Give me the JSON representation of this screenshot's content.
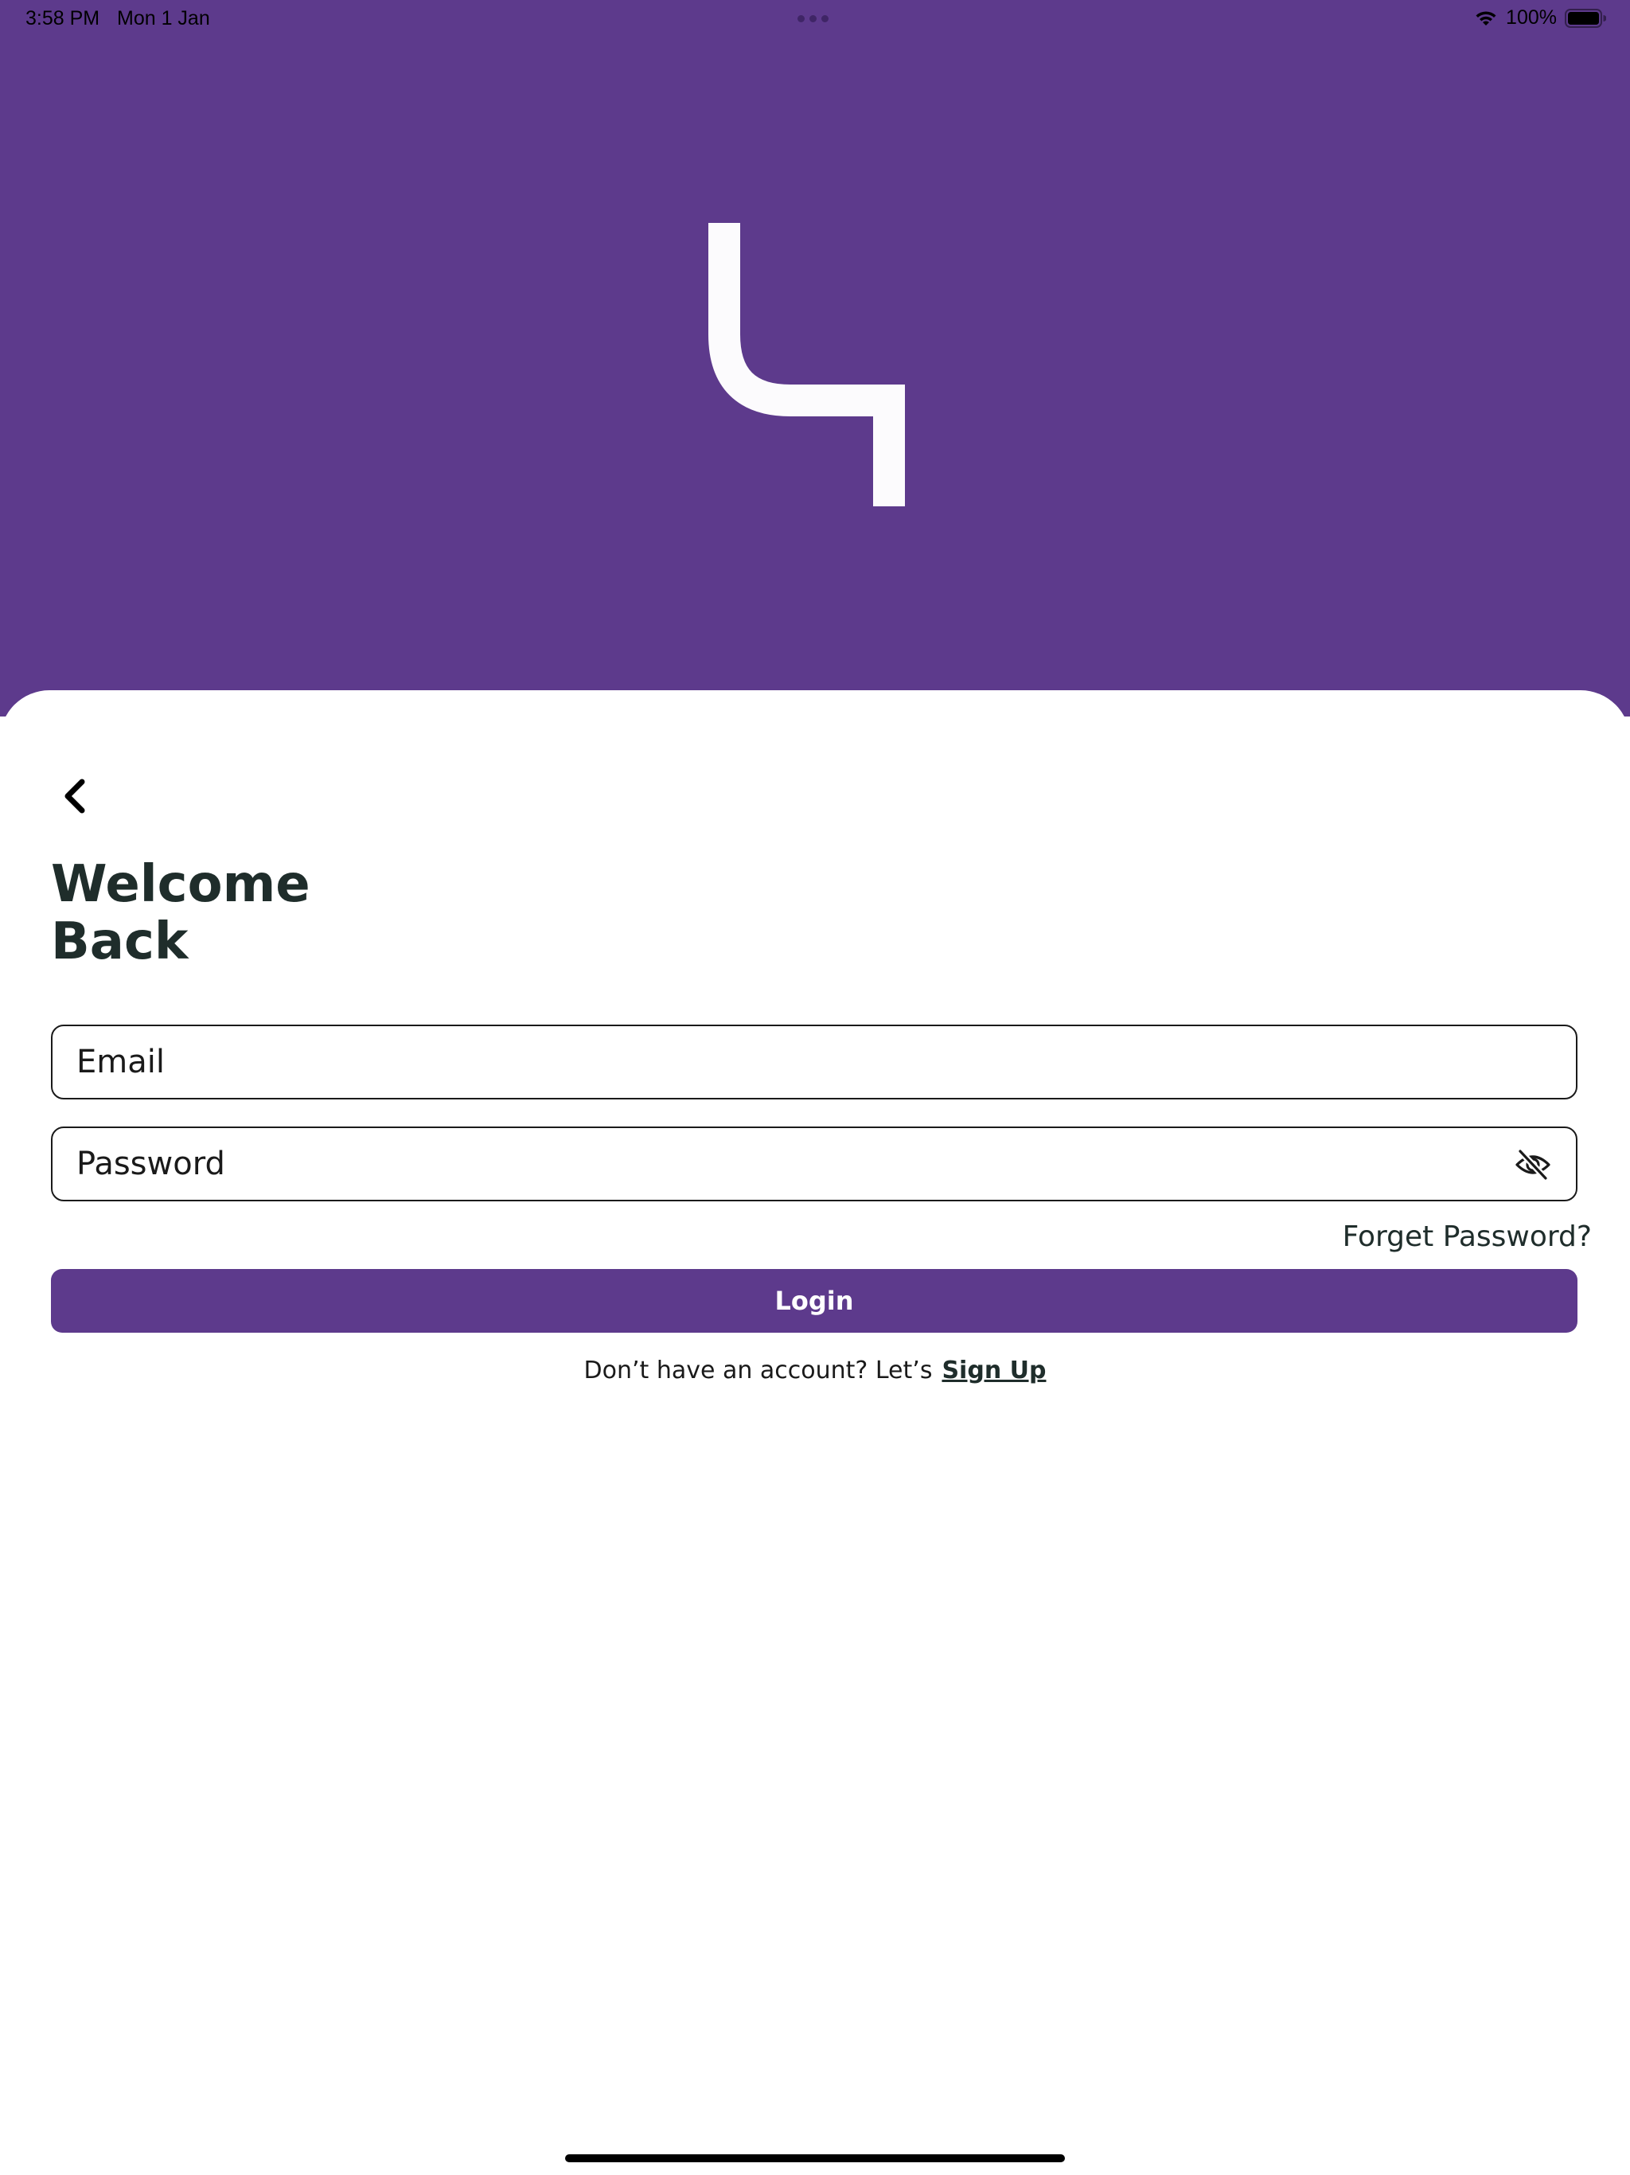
{
  "status_bar": {
    "time": "3:58 PM",
    "date": "Mon 1 Jan",
    "battery_percent": "100%",
    "wifi_icon": "wifi-icon",
    "battery_icon": "battery-full-icon"
  },
  "colors": {
    "brand_purple": "#5d3a8c",
    "heading_text": "#1f2d2b",
    "background": "#ffffff"
  },
  "header": {
    "logo_icon": "angular-hook-logo"
  },
  "login": {
    "back_icon": "chevron-left-icon",
    "title_line1": "Welcome",
    "title_line2": "Back",
    "email": {
      "placeholder": "Email",
      "value": ""
    },
    "password": {
      "placeholder": "Password",
      "value": "",
      "toggle_icon": "eye-off-icon"
    },
    "forgot_password": "Forget Password?",
    "login_button": "Login",
    "signup_prompt": "Don’t have an account? Let’s",
    "signup_link": "Sign Up"
  }
}
